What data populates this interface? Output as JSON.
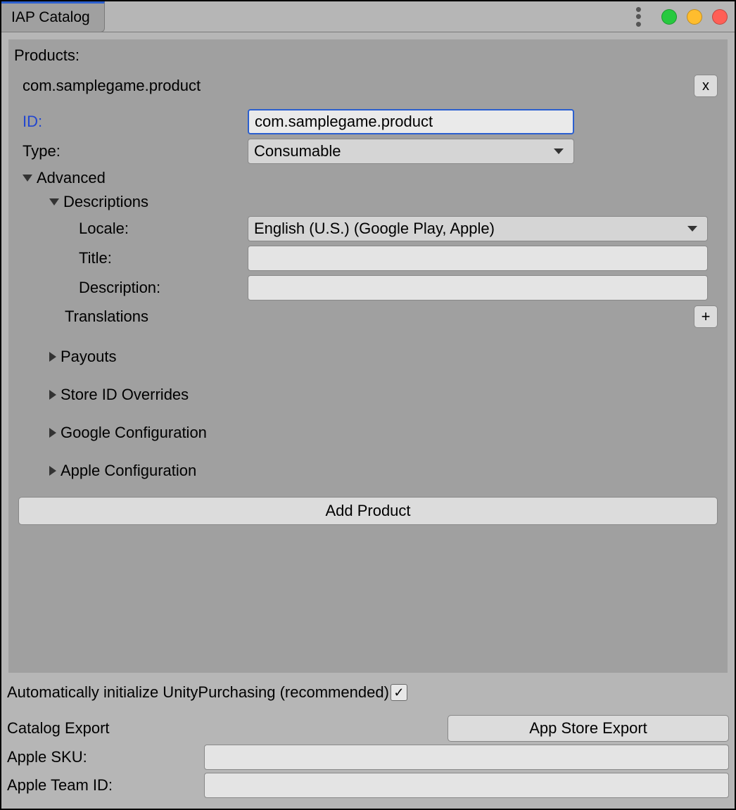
{
  "window": {
    "title": "IAP Catalog"
  },
  "products_label": "Products:",
  "product": {
    "name": "com.samplegame.product",
    "remove_label": "x",
    "id_label": "ID:",
    "id_value": "com.samplegame.product",
    "type_label": "Type:",
    "type_value": "Consumable",
    "advanced_label": "Advanced",
    "descriptions_label": "Descriptions",
    "locale_label": "Locale:",
    "locale_value": "English (U.S.) (Google Play, Apple)",
    "title_label": "Title:",
    "title_value": "",
    "description_label": "Description:",
    "description_value": "",
    "translations_label": "Translations",
    "add_translation_label": "+",
    "payouts_label": "Payouts",
    "store_overrides_label": "Store ID Overrides",
    "google_config_label": "Google Configuration",
    "apple_config_label": "Apple Configuration"
  },
  "add_product_label": "Add Product",
  "auto_init_label": "Automatically initialize UnityPurchasing (recommended)",
  "auto_init_checked": true,
  "catalog_export_label": "Catalog Export",
  "app_store_export_label": "App Store Export",
  "apple_sku_label": "Apple SKU:",
  "apple_sku_value": "",
  "apple_team_label": "Apple Team ID:",
  "apple_team_value": ""
}
